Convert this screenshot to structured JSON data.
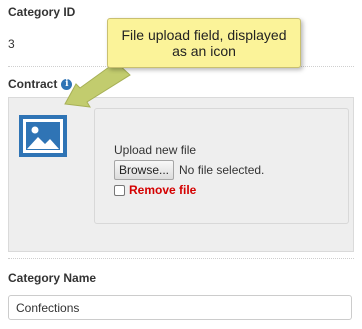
{
  "form": {
    "category_id": {
      "label": "Category ID",
      "value": "3"
    },
    "contract": {
      "label": "Contract",
      "info_icon": "info-icon",
      "preview_icon": "image-icon",
      "upload_label": "Upload new file",
      "browse_label": "Browse...",
      "file_status": "No file selected.",
      "remove_label": "Remove file",
      "remove_checked": false
    },
    "category_name": {
      "label": "Category Name",
      "value": "Confections"
    }
  },
  "callout": {
    "line1": "File upload field, displayed",
    "line2": "as an icon"
  },
  "colors": {
    "accent_blue": "#2f74b5",
    "remove_red": "#d40000",
    "callout_yellow": "#fbf399",
    "arrow_green": "#c2cc6e",
    "panel_gray": "#eeeeee"
  }
}
